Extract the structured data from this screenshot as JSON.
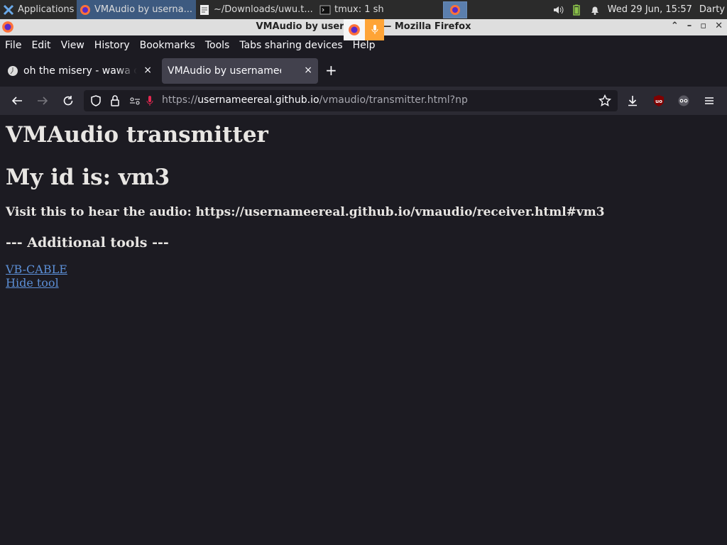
{
  "panel": {
    "applications_label": "Applications",
    "tasks": [
      {
        "label": "VMAudio by userna..."
      },
      {
        "label": "~/Downloads/uwu.t..."
      },
      {
        "label": "tmux: 1 sh"
      }
    ],
    "clock": "Wed 29 Jun, 15:57",
    "user": "Darty"
  },
  "window": {
    "title": "VMAudio by usernamee — Mozilla Firefox"
  },
  "menubar": {
    "items": [
      {
        "label": "File"
      },
      {
        "label": "Edit"
      },
      {
        "label": "View"
      },
      {
        "label": "History"
      },
      {
        "label": "Bookmarks"
      },
      {
        "label": "Tools"
      },
      {
        "label": "Tabs sharing devices"
      },
      {
        "label": "Help"
      }
    ]
  },
  "tabs": [
    {
      "label": "oh the misery - wawa cat",
      "close": "×"
    },
    {
      "label": "VMAudio by usernamee",
      "close": "×"
    }
  ],
  "newtab_label": "+",
  "urlbar": {
    "url_prefix": "https://",
    "url_host": "usernameereal.github.io",
    "url_path": "/vmaudio/transmitter.html?np"
  },
  "page": {
    "heading": "VMAudio transmitter",
    "id_heading": "My id is: vm3",
    "visit_text": "Visit this to hear the audio: https://usernameereal.github.io/vmaudio/receiver.html#vm3",
    "tools_heading": "--- Additional tools ---",
    "links": [
      {
        "label": "VB-CABLE"
      },
      {
        "label": "Hide tool"
      }
    ]
  },
  "colors": {
    "page_bg": "#1c1b22",
    "link": "#5c8fd6",
    "mic_indicator": "#ffa436",
    "ublock": "#800000"
  }
}
